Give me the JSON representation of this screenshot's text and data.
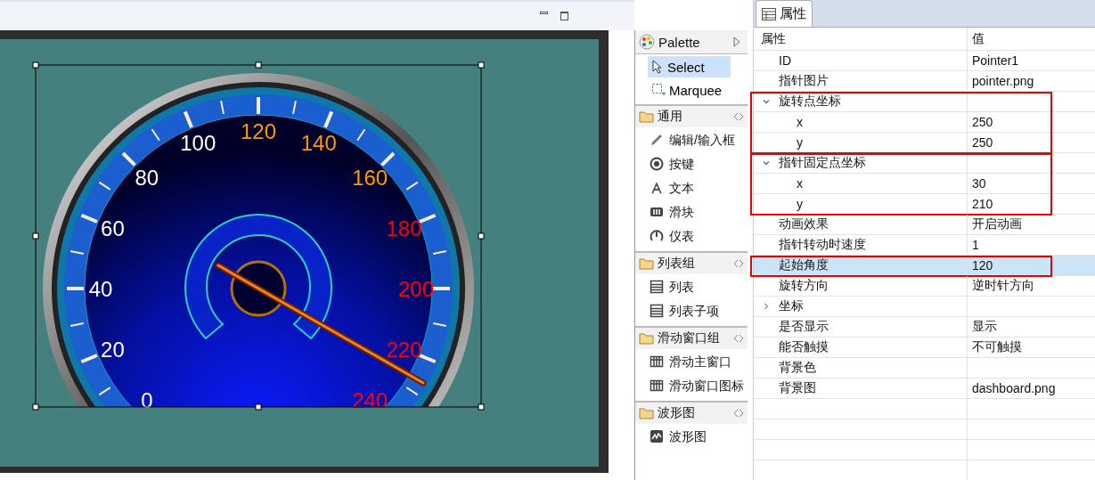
{
  "editor": {
    "gauge": {
      "labels": [
        {
          "text": "0",
          "color": "#ffffff"
        },
        {
          "text": "20",
          "color": "#ffffff"
        },
        {
          "text": "40",
          "color": "#ffffff"
        },
        {
          "text": "60",
          "color": "#ffffff"
        },
        {
          "text": "80",
          "color": "#ffffff"
        },
        {
          "text": "100",
          "color": "#ffffff"
        },
        {
          "text": "120",
          "color": "#ff9900"
        },
        {
          "text": "140",
          "color": "#ff9900"
        },
        {
          "text": "160",
          "color": "#ff9900"
        },
        {
          "text": "180",
          "color": "#ff0000"
        },
        {
          "text": "200",
          "color": "#ff0000"
        },
        {
          "text": "220",
          "color": "#ff0000"
        },
        {
          "text": "240",
          "color": "#ff0000"
        }
      ]
    }
  },
  "palette": {
    "title": "Palette",
    "tools": [
      {
        "label": "Select",
        "kind": "arrow",
        "selected": true
      },
      {
        "label": "Marquee",
        "kind": "marquee",
        "selected": false
      }
    ],
    "drawers": [
      {
        "label": "通用",
        "items": [
          {
            "label": "编辑/输入框",
            "kind": "pencil"
          },
          {
            "label": "按键",
            "kind": "radio"
          },
          {
            "label": "文本",
            "kind": "letter"
          },
          {
            "label": "滑块",
            "kind": "slider"
          },
          {
            "label": "仪表",
            "kind": "gauge"
          }
        ]
      },
      {
        "label": "列表组",
        "items": [
          {
            "label": "列表",
            "kind": "list"
          },
          {
            "label": "列表子项",
            "kind": "list"
          }
        ]
      },
      {
        "label": "滑动窗口组",
        "items": [
          {
            "label": "滑动主窗口",
            "kind": "grid"
          },
          {
            "label": "滑动窗口图标",
            "kind": "grid"
          }
        ]
      },
      {
        "label": "波形图",
        "items": [
          {
            "label": "波形图",
            "kind": "wave"
          }
        ]
      }
    ]
  },
  "properties": {
    "tab": "属性",
    "columns": [
      "属性",
      "值"
    ],
    "rows": [
      {
        "name": "ID",
        "value": "Pointer1",
        "selected": false
      },
      {
        "name": "指针图片",
        "value": "pointer.png",
        "selected": false
      },
      {
        "name": "旋转点坐标",
        "selected": false,
        "expanded": true,
        "annotated": true,
        "children": [
          {
            "name": "x",
            "value": "250",
            "selected": false
          },
          {
            "name": "y",
            "value": "250",
            "selected": false
          }
        ]
      },
      {
        "name": "指针固定点坐标",
        "selected": false,
        "expanded": true,
        "annotated": true,
        "children": [
          {
            "name": "x",
            "value": "30",
            "selected": false
          },
          {
            "name": "y",
            "value": "210",
            "selected": false
          }
        ]
      },
      {
        "name": "动画效果",
        "value": "开启动画",
        "selected": false
      },
      {
        "name": "指针转动时速度",
        "value": "1",
        "selected": false
      },
      {
        "name": "起始角度",
        "value": "120",
        "selected": true,
        "annotated": true
      },
      {
        "name": "旋转方向",
        "value": "逆时针方向",
        "selected": false
      },
      {
        "name": "坐标",
        "selected": false,
        "expanded": false
      },
      {
        "name": "是否显示",
        "value": "显示",
        "selected": false
      },
      {
        "name": "能否触摸",
        "value": "不可触摸",
        "selected": false
      },
      {
        "name": "背景色",
        "selected": false
      },
      {
        "name": "背景图",
        "value": "dashboard.png",
        "selected": false
      }
    ]
  }
}
